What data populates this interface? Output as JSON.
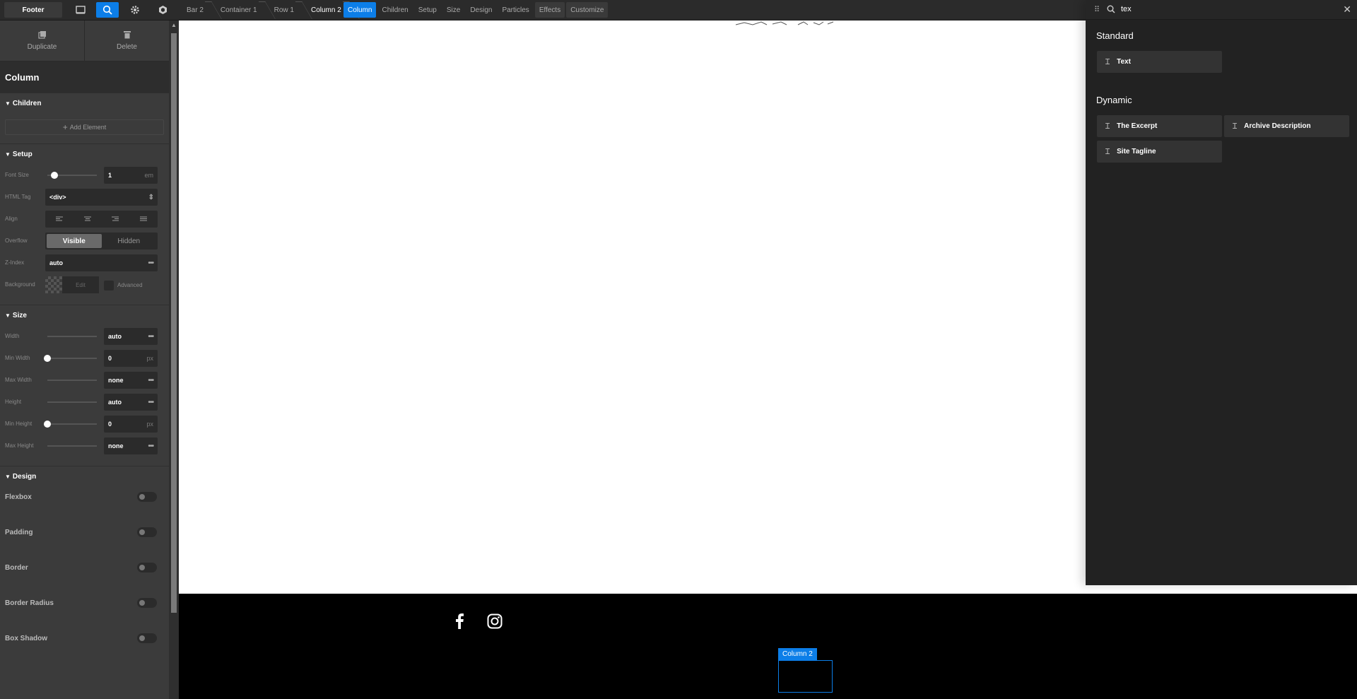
{
  "topbar": {
    "document_label": "Footer",
    "icons": [
      "panel-icon",
      "search-icon",
      "gear-icon",
      "cube-icon"
    ],
    "breadcrumbs": [
      "Bar 2",
      "Container 1",
      "Row 1",
      "Column 2"
    ],
    "tabs": [
      "Column",
      "Children",
      "Setup",
      "Size",
      "Design",
      "Particles",
      "Effects",
      "Customize"
    ]
  },
  "left": {
    "duplicate_label": "Duplicate",
    "delete_label": "Delete",
    "title": "Column",
    "children": {
      "heading": "Children",
      "add_label": "Add Element"
    },
    "setup": {
      "heading": "Setup",
      "font_size": {
        "label": "Font Size",
        "value": "1",
        "unit": "em",
        "slider": 0.15
      },
      "html_tag": {
        "label": "HTML Tag",
        "value": "<div>"
      },
      "align": {
        "label": "Align"
      },
      "overflow": {
        "label": "Overflow",
        "options": [
          "Visible",
          "Hidden"
        ],
        "selected": "Visible"
      },
      "z_index": {
        "label": "Z-Index",
        "value": "auto"
      },
      "background": {
        "label": "Background",
        "edit": "Edit",
        "advanced": "Advanced"
      }
    },
    "size": {
      "heading": "Size",
      "width": {
        "label": "Width",
        "value": "auto"
      },
      "min_width": {
        "label": "Min Width",
        "value": "0",
        "unit": "px",
        "slider": 0
      },
      "max_width": {
        "label": "Max Width",
        "value": "none"
      },
      "height": {
        "label": "Height",
        "value": "auto"
      },
      "min_height": {
        "label": "Min Height",
        "value": "0",
        "unit": "px",
        "slider": 0
      },
      "max_height": {
        "label": "Max Height",
        "value": "none"
      }
    },
    "design": {
      "heading": "Design",
      "toggles": [
        "Flexbox",
        "Padding",
        "Border",
        "Border Radius",
        "Box Shadow"
      ]
    }
  },
  "canvas": {
    "selected_label": "Column 2"
  },
  "right": {
    "search_value": "tex",
    "standard": {
      "heading": "Standard",
      "items": [
        "Text"
      ]
    },
    "dynamic": {
      "heading": "Dynamic",
      "items": [
        "The Excerpt",
        "Archive Description",
        "Site Tagline"
      ]
    }
  },
  "colors": {
    "accent": "#0c7ee8",
    "panel": "#3b3b3b",
    "dark": "#222222"
  }
}
